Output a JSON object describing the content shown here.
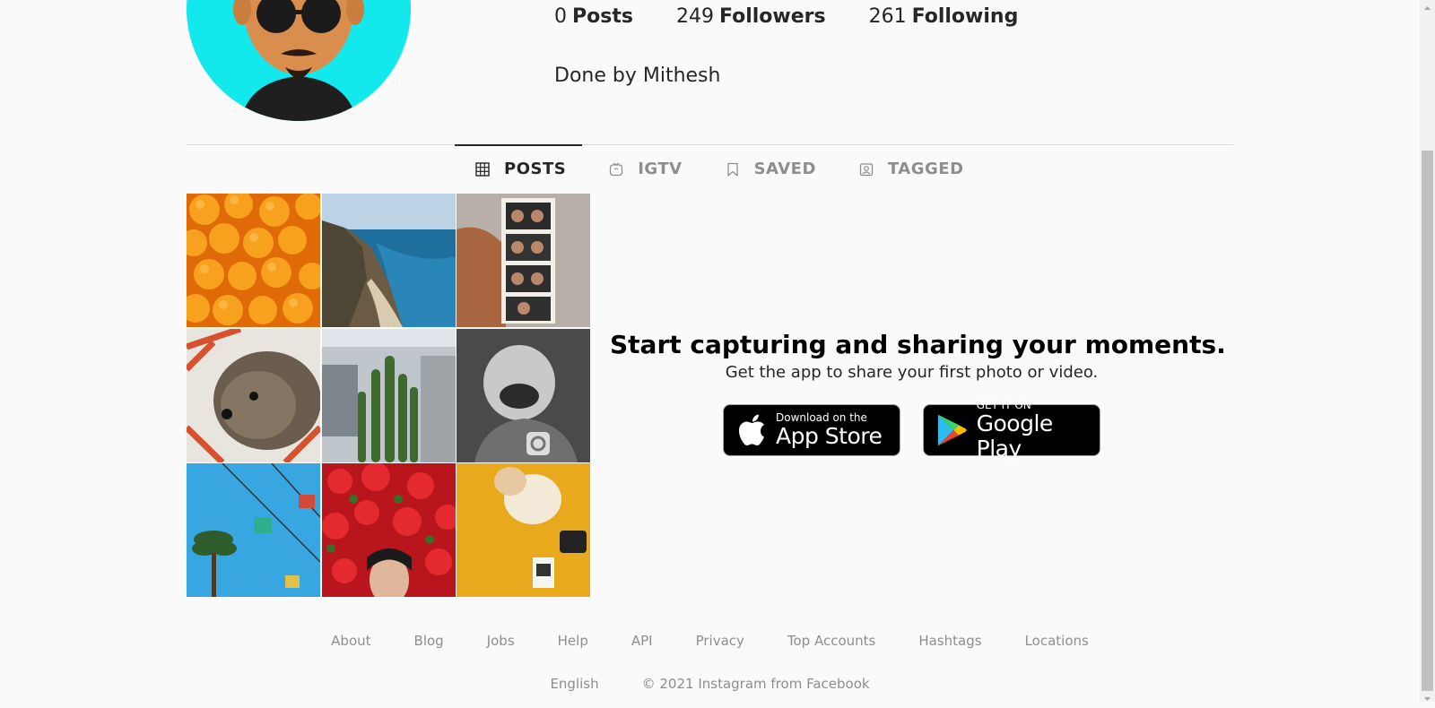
{
  "profile": {
    "posts_count": "0",
    "posts_label": "Posts",
    "followers_count": "249",
    "followers_label": "Followers",
    "following_count": "261",
    "following_label": "Following",
    "bio": "Done by Mithesh"
  },
  "tabs": [
    {
      "label": "POSTS",
      "icon": "grid-icon",
      "active": true
    },
    {
      "label": "IGTV",
      "icon": "igtv-icon",
      "active": false
    },
    {
      "label": "SAVED",
      "icon": "bookmark-icon",
      "active": false
    },
    {
      "label": "TAGGED",
      "icon": "tagged-icon",
      "active": false
    }
  ],
  "promo": {
    "title": "Start capturing and sharing your moments.",
    "subtitle": "Get the app to share your first photo or video.",
    "app_store": {
      "small": "Download on the",
      "big": "App Store"
    },
    "google_play": {
      "small": "GET IT ON",
      "big": "Google Play"
    }
  },
  "footer": {
    "links": [
      "About",
      "Blog",
      "Jobs",
      "Help",
      "API",
      "Privacy",
      "Top Accounts",
      "Hashtags",
      "Locations"
    ],
    "language": "English",
    "copyright": "© 2021 Instagram from Facebook"
  },
  "colors": {
    "avatar_bg": "#13e8ec",
    "text": "#262626",
    "muted": "#8e8e8e"
  }
}
